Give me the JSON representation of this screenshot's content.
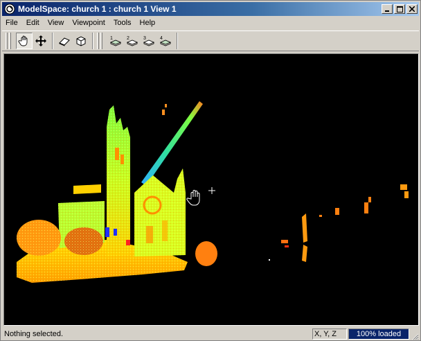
{
  "window": {
    "title": "ModelSpace: church 1 : church 1 View 1",
    "controls": [
      "minimize",
      "maximize",
      "close"
    ]
  },
  "menu": {
    "items": [
      "File",
      "Edit",
      "View",
      "Viewpoint",
      "Tools",
      "Help"
    ]
  },
  "toolbar": {
    "groups": [
      {
        "tools": [
          {
            "icon": "hand-pan-icon",
            "pressed": true
          },
          {
            "icon": "move-arrows-icon",
            "pressed": false
          }
        ]
      },
      {
        "tools": [
          {
            "icon": "eraser-icon",
            "pressed": false
          },
          {
            "icon": "cube-icon",
            "pressed": false
          }
        ]
      },
      {
        "tools": [
          {
            "icon": "view-1-icon"
          },
          {
            "icon": "view-2-icon"
          },
          {
            "icon": "view-3-icon"
          },
          {
            "icon": "view-4-icon"
          }
        ]
      }
    ]
  },
  "viewport": {
    "scene": "church point cloud",
    "background": "#000000",
    "cursor": "hand-cursor-icon"
  },
  "status": {
    "message": "Nothing selected.",
    "coord_label": "X, Y, Z",
    "load_label": "100% loaded",
    "load_fraction": 1.0
  },
  "colors": {
    "title_start": "#0a246a",
    "title_end": "#a6caf0",
    "chrome": "#d4d0c8",
    "progress": "#0a246a"
  }
}
